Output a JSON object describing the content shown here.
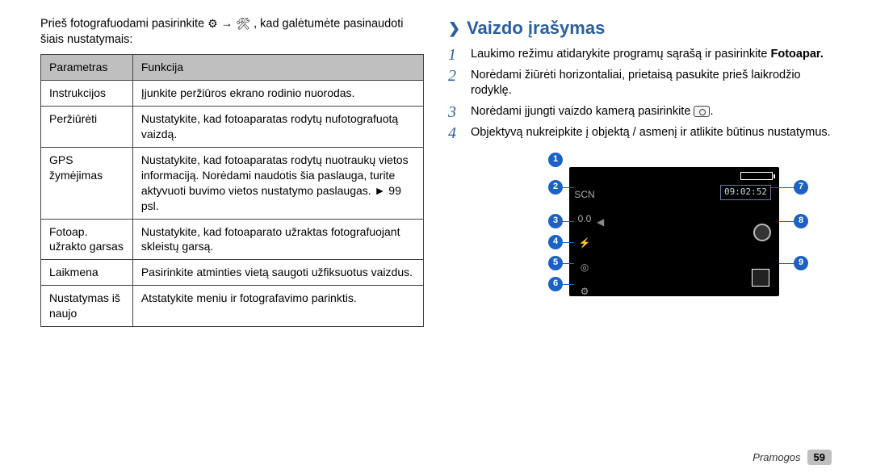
{
  "left": {
    "intro_a": "Prieš fotografuodami pasirinkite ",
    "intro_b": " → ",
    "intro_c": ", kad galėtumėte pasinaudoti šiais nustatymais:",
    "gear_glyph": "⚙",
    "wrench_glyph": "🛠",
    "table": {
      "head_param": "Parametras",
      "head_func": "Funkcija",
      "rows": [
        {
          "p": "Instrukcijos",
          "f": "Įjunkite peržiūros ekrano rodinio nuorodas."
        },
        {
          "p": "Peržiūrėti",
          "f": "Nustatykite, kad fotoaparatas rodytų nufotografuotą vaizdą."
        },
        {
          "p": "GPS žymėjimas",
          "f": "Nustatykite, kad fotoaparatas rodytų nuotraukų vietos informaciją. Norėdami naudotis šia paslauga, turite aktyvuoti buvimo vietos nustatymo paslaugas. ► 99 psl."
        },
        {
          "p": "Fotoap. užrakto garsas",
          "f": "Nustatykite, kad fotoaparato užraktas fotografuojant skleistų garsą."
        },
        {
          "p": "Laikmena",
          "f": "Pasirinkite atminties vietą saugoti užfiksuotus vaizdus."
        },
        {
          "p": "Nustatymas iš naujo",
          "f": "Atstatykite meniu ir fotografavimo parinktis."
        }
      ]
    }
  },
  "right": {
    "section": "Vaizdo įrašymas",
    "steps": [
      {
        "n": "1",
        "text_a": "Laukimo režimu atidarykite programų sąrašą ir pasirinkite ",
        "bold": "Fotoapar."
      },
      {
        "n": "2",
        "text_a": "Norėdami žiūrėti horizontaliai, prietaisą pasukite prieš laikrodžio rodyklę."
      },
      {
        "n": "3",
        "text_a": "Norėdami įjungti vaizdo kamerą pasirinkite ",
        "icon": true,
        "text_b": "."
      },
      {
        "n": "4",
        "text_a": "Objektyvą nukreipkite į objektą / asmenį ir atlikite būtinus nustatymus."
      }
    ],
    "screen": {
      "time": "09:02:52",
      "left_labels": [
        "SCN",
        "0.0",
        "⚡",
        "◎",
        "⚙"
      ],
      "markers": [
        "1",
        "2",
        "3",
        "4",
        "5",
        "6",
        "7",
        "8",
        "9"
      ]
    }
  },
  "footer": {
    "section": "Pramogos",
    "page": "59"
  }
}
